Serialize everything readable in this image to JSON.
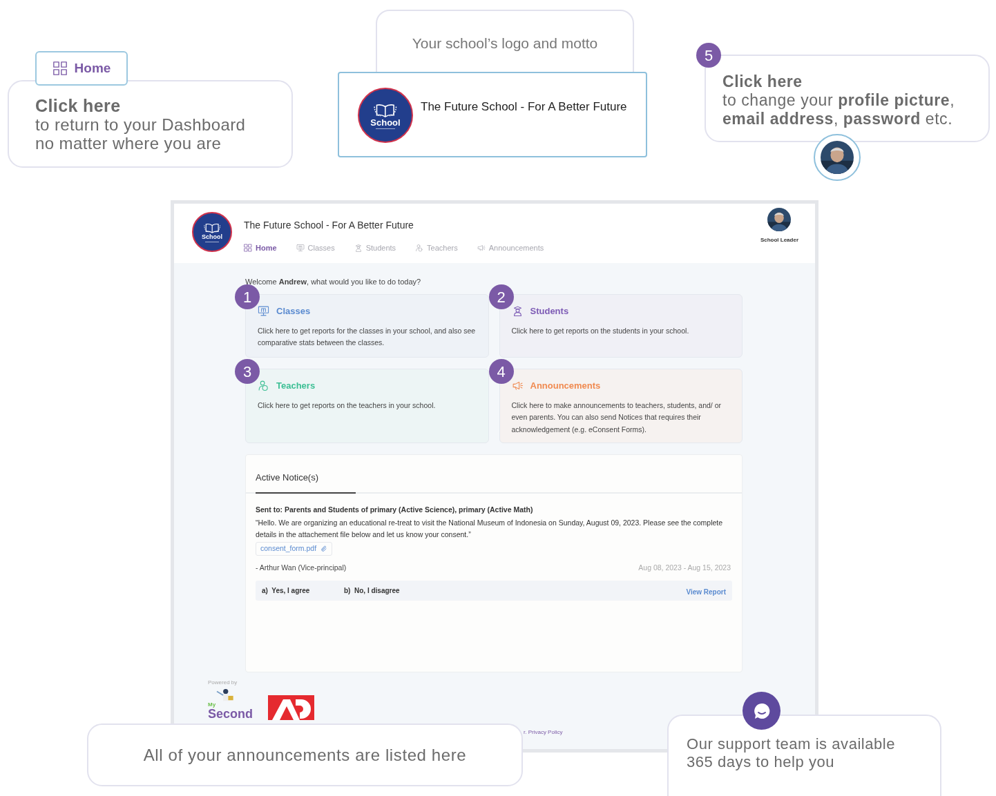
{
  "home_callout": {
    "button_label": "Home",
    "heading": "Click here",
    "text": "to return to your Dashboard\nno matter where you are"
  },
  "logo_callout": {
    "caption": "Your school’s logo and motto",
    "logo_text": "School",
    "motto": "The Future School - For A Better Future"
  },
  "profile_callout": {
    "number": "5",
    "text": "**Click here**\nto change your **profile picture**,\n**email address**, **password** etc."
  },
  "app": {
    "logo_text": "School",
    "title": "The Future School - For A Better Future",
    "nav": [
      {
        "kind": "home",
        "label": "Home",
        "selected": true
      },
      {
        "kind": "classes",
        "label": "Classes",
        "selected": false
      },
      {
        "kind": "students",
        "label": "Students",
        "selected": false
      },
      {
        "kind": "teachers",
        "label": "Teachers",
        "selected": false
      },
      {
        "kind": "announcements",
        "label": "Announcements",
        "selected": false
      }
    ],
    "user_role": "School Leader",
    "welcome": "Welcome **Andrew**, what would you like to do today?",
    "cards": [
      {
        "kind": "classes",
        "number": "1",
        "title": "Classes",
        "description": "Click here to get reports for the classes in your school, and also see comparative stats between the classes.",
        "color": "#5b8bd0"
      },
      {
        "kind": "students",
        "number": "2",
        "title": "Students",
        "description": "Click here to get reports on the students in your school.",
        "color": "#7d5bb5"
      },
      {
        "kind": "teachers",
        "number": "3",
        "title": "Teachers",
        "description": "Click here to get reports on the teachers in your school.",
        "color": "#3cbf94"
      },
      {
        "kind": "announcements",
        "number": "4",
        "title": "Announcements",
        "description": "Click here to make announcements to teachers, students, and/ or even parents. You can also send Notices that requires their acknowledgement (e.g. eConsent Forms).",
        "color": "#f08a50"
      }
    ],
    "notices": {
      "tab": "Active Notice(s)",
      "sent_to": "Sent to: Parents and Students of primary (Active Science), primary (Active Math)",
      "message": "“Hello. We are organizing an educational re-treat to visit the National Museum of Indonesia on Sunday, August 09, 2023. Please see the complete details in the attachement file below and let us know your consent.”",
      "attachment": "consent_form.pdf",
      "author": "- Arthur Wan (Vice-principal)",
      "dates": "Aug 08, 2023 - Aug 15, 2023",
      "options": [
        {
          "letter": "a)",
          "label": "Yes, I agree"
        },
        {
          "letter": "b)",
          "label": "No, I disagree"
        }
      ],
      "report_link": "View Report"
    },
    "footer": {
      "powered_by": "Powered by",
      "brand_top": "My",
      "brand": "Second",
      "links": "r. Privacy Policy"
    }
  },
  "announcements_callout": {
    "text": "All of your announcements are listed here"
  },
  "support_callout": {
    "text": "Our support team is available\n365 days to help you"
  }
}
